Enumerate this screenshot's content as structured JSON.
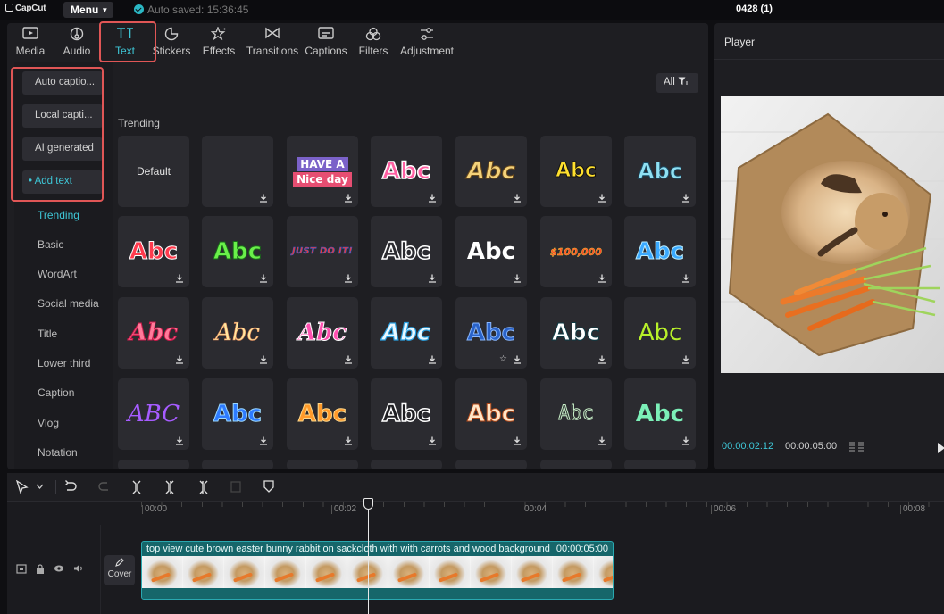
{
  "app": {
    "logo": "CapCut",
    "menu_label": "Menu",
    "autosave": "Auto saved: 15:36:45",
    "project_title": "0428 (1)"
  },
  "tabs": [
    {
      "label": "Media",
      "icon": "media-icon"
    },
    {
      "label": "Audio",
      "icon": "audio-icon"
    },
    {
      "label": "Text",
      "icon": "text-icon",
      "active": true
    },
    {
      "label": "Stickers",
      "icon": "stickers-icon"
    },
    {
      "label": "Effects",
      "icon": "effects-icon"
    },
    {
      "label": "Transitions",
      "icon": "transitions-icon"
    },
    {
      "label": "Captions",
      "icon": "captions-icon"
    },
    {
      "label": "Filters",
      "icon": "filters-icon"
    },
    {
      "label": "Adjustment",
      "icon": "adjustment-icon"
    }
  ],
  "text_panel": {
    "buttons": [
      "Auto captio...",
      "Local capti...",
      "AI generated",
      "Add text"
    ],
    "categories": [
      "Trending",
      "Basic",
      "WordArt",
      "Social media",
      "Title",
      "Lower third",
      "Caption",
      "Vlog",
      "Notation"
    ],
    "filter_label": "All",
    "section_label": "Trending",
    "default_label": "Default",
    "presets": {
      "have_a": "HAVE A",
      "nice_day": "Nice day",
      "abc": "Abc",
      "abc_upper": "ABC",
      "just_do_it": "JUST DO IT!",
      "money": "$100,000"
    }
  },
  "player": {
    "title": "Player",
    "current_time": "00:00:02:12",
    "total_time": "00:00:05:00"
  },
  "timeline": {
    "ticks": [
      "00:00",
      "00:02",
      "00:04",
      "00:06",
      "00:08"
    ],
    "clip_label": "top view cute brown easter bunny rabbit on sackcloth with with carrots and wood background",
    "clip_duration": "00:00:05:00",
    "cover_label": "Cover"
  },
  "colors": {
    "accent": "#3ec6d6",
    "highlight_box": "#e05656",
    "clip": "#16666a"
  }
}
